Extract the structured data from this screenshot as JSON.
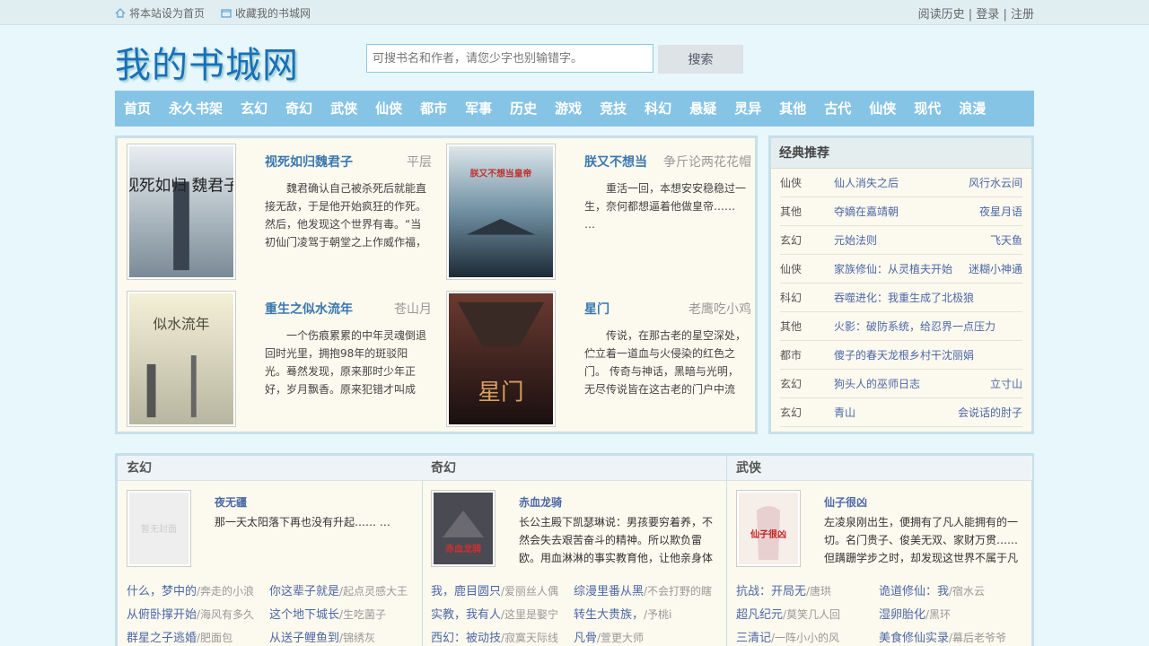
{
  "topbar": {
    "set_home": "将本站设为首页",
    "bookmark": "收藏我的书城网",
    "history": "阅读历史",
    "sep": "|",
    "login": "登录",
    "register": "注册"
  },
  "logo": "我的书城网",
  "search": {
    "placeholder": "可搜书名和作者，请您少字也别输错字。",
    "button": "搜索"
  },
  "nav": [
    "首页",
    "永久书架",
    "玄幻",
    "奇幻",
    "武侠",
    "仙侠",
    "都市",
    "军事",
    "历史",
    "游戏",
    "竞技",
    "科幻",
    "悬疑",
    "灵异",
    "其他",
    "古代",
    "仙侠",
    "现代",
    "浪漫"
  ],
  "featured": [
    {
      "title": "视死如归魏君子",
      "author": "平层",
      "desc": "魏君确认自己被杀死后就能直接无敌，于是他开始疯狂的作死。然后，他发现这个世界有毒。“当初仙门凌驾于朝堂之上作威作福，",
      "cover_text": "视死如归 魏君子"
    },
    {
      "title": "朕又不想当",
      "author": "争斤论两花花帽",
      "desc": "重活一回，本想安安稳稳过一生，奈何都想逼着他做皇帝…… …",
      "cover_text": "朕又不想当皇帝"
    },
    {
      "title": "重生之似水流年",
      "author": "苍山月",
      "desc": "一个伤痕累累的中年灵魂倒退回时光里，拥抱98年的斑驳阳光。蓦然发现，原来那时少年正好，岁月飘香。原来犯错才叫成长，青春",
      "cover_text": "似水流年"
    },
    {
      "title": "星门",
      "author": "老鹰吃小鸡",
      "desc": "传说，在那古老的星空深处，伫立着一道血与火侵染的红色之门。 传奇与神话，黑暗与光明，无尽传说皆在这古老的门户中流",
      "cover_text": "星门"
    }
  ],
  "recommend": {
    "title": "经典推荐",
    "items": [
      {
        "cat": "仙侠",
        "name": "仙人消失之后",
        "author": "风行水云间"
      },
      {
        "cat": "其他",
        "name": "夺嫡在嘉靖朝",
        "author": "夜星月语"
      },
      {
        "cat": "玄幻",
        "name": "元始法则",
        "author": "飞天鱼"
      },
      {
        "cat": "仙侠",
        "name": "家族修仙：从灵植夫开始",
        "author": "迷糊小神通"
      },
      {
        "cat": "科幻",
        "name": "吞噬进化：我重生成了北极狼",
        "author": ""
      },
      {
        "cat": "其他",
        "name": "火影：破防系统，给忍界一点压力",
        "author": ""
      },
      {
        "cat": "都市",
        "name": "傻子的春天龙根乡村干沈丽娟",
        "author": ""
      },
      {
        "cat": "玄幻",
        "name": "狗头人的巫师日志",
        "author": "立寸山"
      },
      {
        "cat": "玄幻",
        "name": "青山",
        "author": "会说话的肘子"
      }
    ]
  },
  "categories": [
    {
      "name": "玄幻",
      "top": {
        "title": "夜无疆",
        "desc": "那一天太阳落下再也没有升起…… …",
        "cover_text": "暂无封面"
      },
      "list": [
        [
          {
            "t": "什么，梦中的",
            "a": "/奔走的小浪"
          },
          {
            "t": "你这辈子就是",
            "a": "/起点灵感大王"
          }
        ],
        [
          {
            "t": "从俯卧撑开始",
            "a": "/海风有多久"
          },
          {
            "t": "这个地下城长",
            "a": "/生吃菌子"
          }
        ],
        [
          {
            "t": "群星之子逃婚",
            "a": "/肥面包"
          },
          {
            "t": "从送子鲤鱼到",
            "a": "/锦绣灰"
          }
        ]
      ]
    },
    {
      "name": "奇幻",
      "top": {
        "title": "赤血龙骑",
        "desc": "长公主殿下凯瑟琳说：男孩要穷着养，不然会失去艰苦奋斗的精神。所以欺负雷欧。用血淋淋的事实教育他，让他亲身体",
        "cover_text": "赤血龙骑"
      },
      "list": [
        [
          {
            "t": "我，鹿目圆只",
            "a": "/爱丽丝人偶"
          },
          {
            "t": "综漫里番从黑",
            "a": "/不会打野的瞎"
          }
        ],
        [
          {
            "t": "实教，我有人",
            "a": "/这里是娶宁"
          },
          {
            "t": "转生大贵族，",
            "a": "/予桃i"
          }
        ],
        [
          {
            "t": "西幻：被动技",
            "a": "/寂寞天际线"
          },
          {
            "t": "凡骨",
            "a": "/萱更大师"
          }
        ]
      ]
    },
    {
      "name": "武侠",
      "top": {
        "title": "仙子很凶",
        "desc": "左凌泉刚出生，便拥有了凡人能拥有的一切。名门贵子、俊美无双、家财万贯……但蹒跚学步之时，却发现这世界不属于凡",
        "cover_text": "仙子很凶"
      },
      "list": [
        [
          {
            "t": "抗战：开局无",
            "a": "/唐珙"
          },
          {
            "t": "诡道修仙：我",
            "a": "/宿水云"
          }
        ],
        [
          {
            "t": "超凡纪元",
            "a": "/莫笑几人回"
          },
          {
            "t": "湿卵胎化",
            "a": "/黑环"
          }
        ],
        [
          {
            "t": "三清记",
            "a": "/一阵小小的风"
          },
          {
            "t": "美食修仙实录",
            "a": "/幕后老爷爷"
          }
        ]
      ]
    }
  ],
  "colors": {
    "nav_bg": "#86c4e6",
    "link": "#4b68a6",
    "title_link": "#3a78b0",
    "logo": "#1a6fb8",
    "page_bg": "#e8f7fc",
    "panel_bg": "#fcf9ee"
  }
}
